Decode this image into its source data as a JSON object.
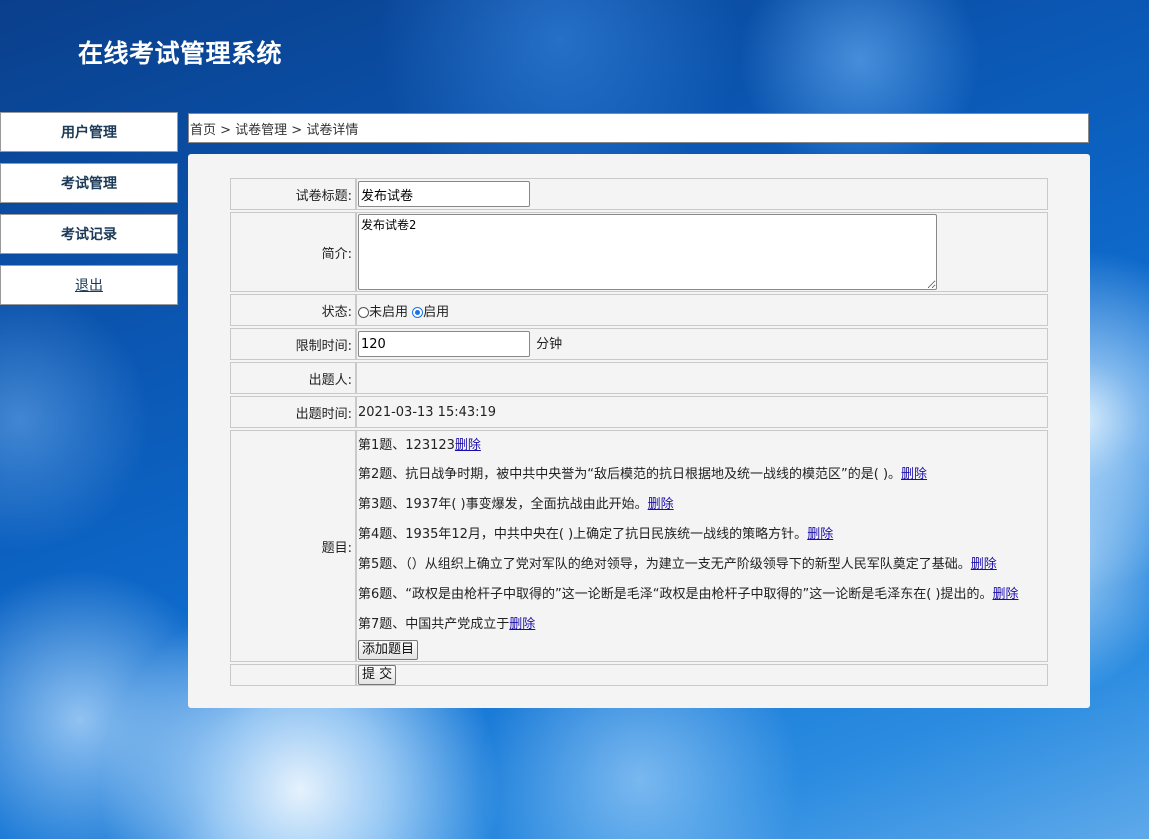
{
  "app": {
    "title": "在线考试管理系统"
  },
  "sidebar": {
    "items": [
      {
        "label": "用户管理"
      },
      {
        "label": "考试管理"
      },
      {
        "label": "考试记录"
      },
      {
        "label": "退出"
      }
    ]
  },
  "breadcrumb": {
    "text": "首页 > 试卷管理 > 试卷详情"
  },
  "form": {
    "title_label": "试卷标题:",
    "title_value": "发布试卷",
    "intro_label": "简介:",
    "intro_value": "发布试卷2",
    "status_label": "状态:",
    "status_options": [
      {
        "label": "未启用",
        "selected": false
      },
      {
        "label": "启用",
        "selected": true
      }
    ],
    "time_limit_label": "限制时间:",
    "time_limit_value": "120",
    "time_limit_unit": "分钟",
    "author_label": "出题人:",
    "author_value": "",
    "created_label": "出题时间:",
    "created_value": "2021-03-13 15:43:19",
    "questions_label": "题目:",
    "questions": [
      {
        "text": "第1题、123123",
        "action": "删除"
      },
      {
        "text": "第2题、抗日战争时期，被中共中央誉为“敌后模范的抗日根据地及统一战线的模范区”的是( )。",
        "action": "删除"
      },
      {
        "text": "第3题、1937年( )事变爆发，全面抗战由此开始。",
        "action": "删除"
      },
      {
        "text": "第4题、1935年12月，中共中央在( )上确定了抗日民族统一战线的策略方针。",
        "action": "删除"
      },
      {
        "text": "第5题、（）从组织上确立了党对军队的绝对领导，为建立一支无产阶级领导下的新型人民军队奠定了基础。",
        "action": "删除"
      },
      {
        "text": "第6题、“政权是由枪杆子中取得的”这一论断是毛泽“政权是由枪杆子中取得的”这一论断是毛泽东在( )提出的。",
        "action": "删除"
      },
      {
        "text": "第7题、中国共产党成立于",
        "action": "删除"
      }
    ],
    "add_question_label": "添加题目",
    "submit_label": "提 交"
  }
}
